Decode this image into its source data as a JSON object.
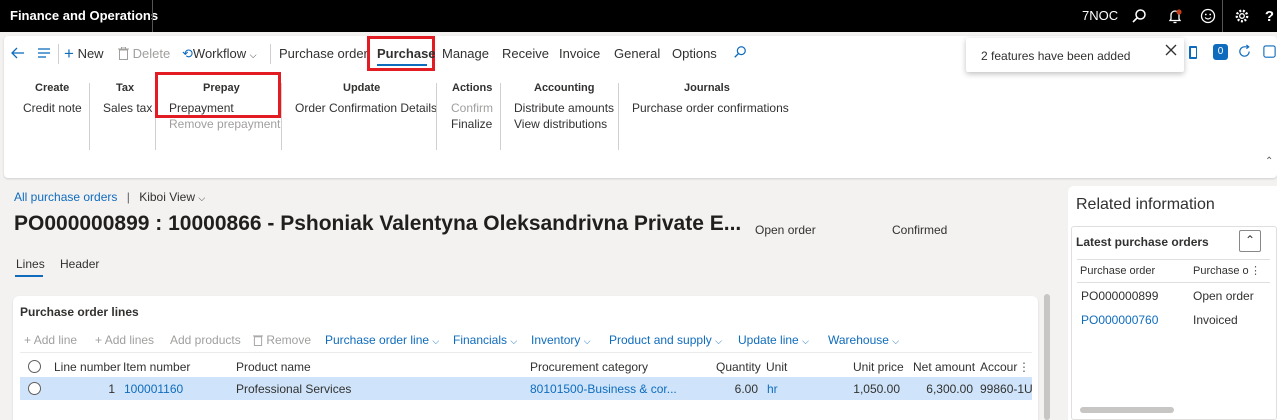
{
  "topbar": {
    "app_name": "Finance and Operations",
    "company": "7NOC",
    "icons": [
      "search-icon",
      "notifications-icon",
      "feedback-smiley-icon",
      "settings-gear-icon",
      "help-icon"
    ]
  },
  "toolbar": {
    "new_label": "New",
    "delete_label": "Delete",
    "workflow_label": "Workflow",
    "tabs": [
      "Purchase order",
      "Purchase",
      "Manage",
      "Receive",
      "Invoice",
      "General",
      "Options"
    ],
    "active_tab": "Purchase",
    "notification_count": "0"
  },
  "toast": {
    "message": "2 features have been added"
  },
  "ribbon": {
    "create": {
      "header": "Create",
      "items": [
        "Credit note"
      ]
    },
    "tax": {
      "header": "Tax",
      "items": [
        "Sales tax"
      ]
    },
    "prepay": {
      "header": "Prepay",
      "items": [
        "Prepayment",
        "Remove prepayment"
      ]
    },
    "update": {
      "header": "Update",
      "items": [
        "Order Confirmation Details"
      ]
    },
    "actions": {
      "header": "Actions",
      "items": [
        "Confirm",
        "Finalize"
      ]
    },
    "accounting": {
      "header": "Accounting",
      "items": [
        "Distribute amounts",
        "View distributions"
      ]
    },
    "journals": {
      "header": "Journals",
      "items": [
        "Purchase order confirmations"
      ]
    }
  },
  "breadcrumb": {
    "link": "All purchase orders",
    "separator": "|",
    "view": "Kiboi View"
  },
  "header": {
    "title": "PO000000899 : 10000866 - Pshoniak Valentyna Oleksandrivna Private E...",
    "status": "Open order",
    "approval": "Confirmed"
  },
  "page_tabs": [
    "Lines",
    "Header"
  ],
  "lines_card": {
    "title": "Purchase order lines",
    "toolbar": [
      "Add line",
      "Add lines",
      "Add products",
      "Remove"
    ],
    "menus": [
      "Purchase order line",
      "Financials",
      "Inventory",
      "Product and supply",
      "Update line",
      "Warehouse"
    ],
    "columns": [
      "Line number",
      "Item number",
      "Product name",
      "Procurement category",
      "Quantity",
      "Unit",
      "Unit price",
      "Net amount",
      "Accour"
    ],
    "rows": [
      {
        "line_number": "1",
        "item_number": "100001160",
        "product_name": "Professional Services",
        "category": "80101500-Business & cor...",
        "quantity": "6.00",
        "unit": "hr",
        "unit_price": "1,050.00",
        "net_amount": "6,300.00",
        "account": "99860-1U"
      }
    ]
  },
  "related": {
    "title": "Related information",
    "section": "Latest purchase orders",
    "columns": [
      "Purchase order",
      "Purchase o"
    ],
    "rows": [
      {
        "po": "PO000000899",
        "status": "Open order"
      },
      {
        "po": "PO000000760",
        "status": "Invoiced"
      }
    ]
  },
  "colors": {
    "accent": "#0f6cbd",
    "highlight": "#e31c23",
    "selected_row": "#cfe4fa"
  }
}
